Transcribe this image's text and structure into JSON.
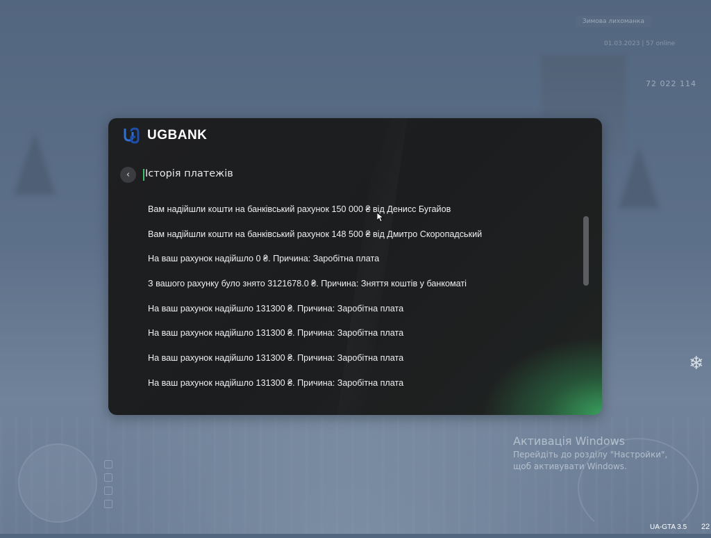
{
  "background": {
    "server_badge": "Зимова лихоманка",
    "server_info": "01.03.2023  |  57 online",
    "money": "72 022 114"
  },
  "bank": {
    "brand": "UGBANK",
    "title": "Історія платежів",
    "accent_color": "#41c06e",
    "items": [
      "Вам надійшли кошти на банківський рахунок 150 000 ₴ від Денисс Бугайов",
      "Вам надійшли кошти на банківський рахунок 148 500 ₴ від Дмитро Скоропадський",
      "На ваш рахунок надійшло 0 ₴. Причина: Заробітна плата",
      "З вашого рахунку було знято 3121678.0 ₴. Причина: Зняття коштів у банкоматі",
      "На ваш рахунок надійшло 131300 ₴. Причина: Заробітна плата",
      "На ваш рахунок надійшло 131300 ₴. Причина: Заробітна плата",
      "На ваш рахунок надійшло 131300 ₴. Причина: Заробітна плата",
      "На ваш рахунок надійшло 131300 ₴. Причина: Заробітна плата"
    ]
  },
  "windows": {
    "title": "Активація Windows",
    "line1": "Перейдіть до розділу \"Настройки\",",
    "line2": "щоб активувати Windows."
  },
  "footer": {
    "version": "UA-GTA 3.5",
    "clock": "22"
  }
}
